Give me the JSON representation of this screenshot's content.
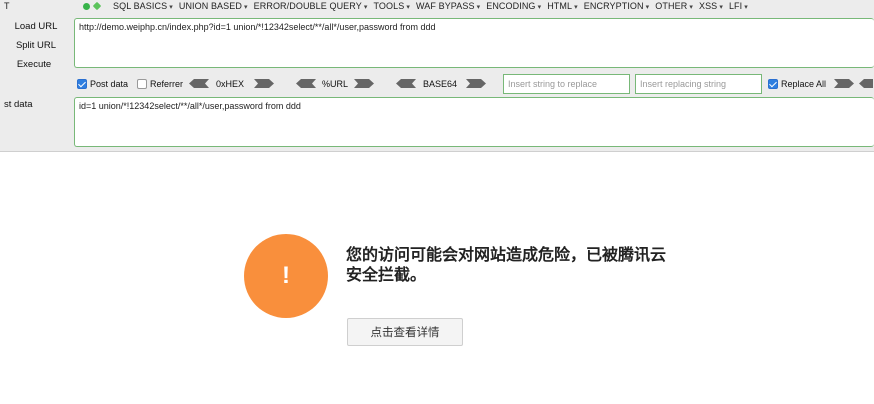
{
  "menubar": {
    "edge_char": "T",
    "items": [
      "SQL BASICS",
      "UNION BASED",
      "ERROR/DOUBLE QUERY",
      "TOOLS",
      "WAF BYPASS",
      "ENCODING",
      "HTML",
      "ENCRYPTION",
      "OTHER",
      "XSS",
      "LFI"
    ]
  },
  "side_buttons": {
    "load_url": "Load URL",
    "split_url": "Split URL",
    "execute": "Execute"
  },
  "url_field": {
    "value": "http://demo.weiphp.cn/index.php?id=1 union/*!12342select/**/all*/user,password from ddd"
  },
  "toolbar": {
    "post_data_label": "Post data",
    "post_data_checked": true,
    "referrer_label": "Referrer",
    "referrer_checked": false,
    "hex_label": "0xHEX",
    "url_label": "%URL",
    "base64_label": "BASE64",
    "replace_placeholder": "Insert string to replace",
    "replacing_placeholder": "Insert replacing string",
    "replace_all_label": "Replace All",
    "replace_all_checked": true
  },
  "post_data": {
    "label": "st data",
    "value": "id=1 union/*!12342select/**/all*/user,password from ddd"
  },
  "block_page": {
    "icon_symbol": "!",
    "message": "您的访问可能会对网站造成危险，已被腾讯云安全拦截。",
    "detail_button": "点击查看详情",
    "accent_color": "#f98f3c"
  }
}
